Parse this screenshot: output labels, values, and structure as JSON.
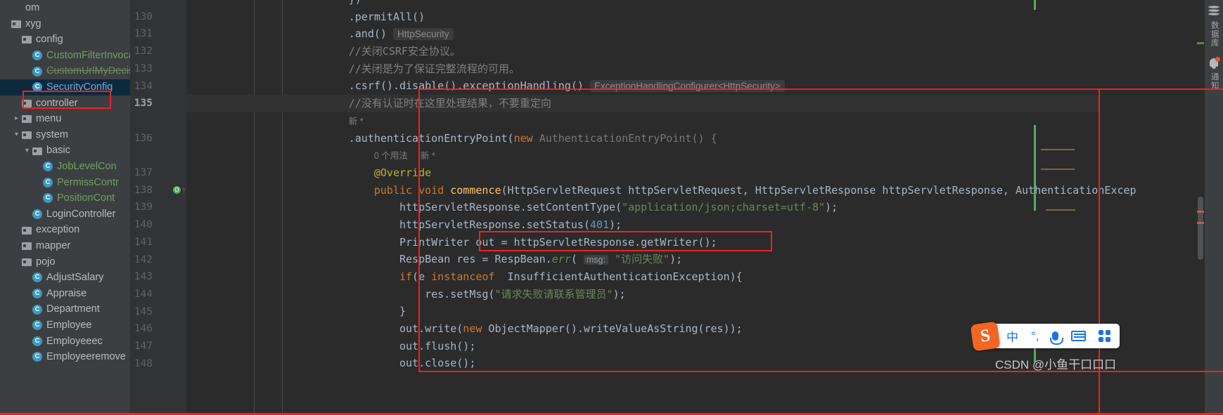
{
  "project_tree": {
    "name": "project-tool-window",
    "items": [
      {
        "depth": 0,
        "arrow": "",
        "icon": "none",
        "label": "om",
        "style": "gray"
      },
      {
        "depth": 0,
        "arrow": "",
        "icon": "folder",
        "label": "xyg",
        "style": "gray"
      },
      {
        "depth": 1,
        "arrow": "",
        "icon": "folder",
        "label": "config",
        "style": "gray"
      },
      {
        "depth": 2,
        "arrow": "",
        "icon": "class",
        "label": "CustomFilterInvoca",
        "style": "green"
      },
      {
        "depth": 2,
        "arrow": "",
        "icon": "class",
        "label": "CustomUrlMyDecis",
        "style": "struck"
      },
      {
        "depth": 2,
        "arrow": "",
        "icon": "class",
        "label": "SecurityConfig",
        "style": "selected",
        "selected": true
      },
      {
        "depth": 1,
        "arrow": "",
        "icon": "folder",
        "label": "controller",
        "style": "gray"
      },
      {
        "depth": 1,
        "arrow": "collapsed",
        "icon": "folder",
        "label": "menu",
        "style": "gray"
      },
      {
        "depth": 1,
        "arrow": "expanded",
        "icon": "folder",
        "label": "system",
        "style": "gray"
      },
      {
        "depth": 2,
        "arrow": "expanded",
        "icon": "folder",
        "label": "basic",
        "style": "gray"
      },
      {
        "depth": 3,
        "arrow": "",
        "icon": "class",
        "label": "JobLevelCon",
        "style": "green"
      },
      {
        "depth": 3,
        "arrow": "",
        "icon": "class",
        "label": "PermissContr",
        "style": "green"
      },
      {
        "depth": 3,
        "arrow": "",
        "icon": "class",
        "label": "PositionCont",
        "style": "green"
      },
      {
        "depth": 2,
        "arrow": "",
        "icon": "class",
        "label": "LoginController",
        "style": "gray"
      },
      {
        "depth": 1,
        "arrow": "",
        "icon": "folder",
        "label": "exception",
        "style": "gray"
      },
      {
        "depth": 1,
        "arrow": "",
        "icon": "folder",
        "label": "mapper",
        "style": "gray"
      },
      {
        "depth": 1,
        "arrow": "",
        "icon": "folder",
        "label": "pojo",
        "style": "gray"
      },
      {
        "depth": 2,
        "arrow": "",
        "icon": "class",
        "label": "AdjustSalary",
        "style": "gray"
      },
      {
        "depth": 2,
        "arrow": "",
        "icon": "class",
        "label": "Appraise",
        "style": "gray"
      },
      {
        "depth": 2,
        "arrow": "",
        "icon": "class",
        "label": "Department",
        "style": "gray"
      },
      {
        "depth": 2,
        "arrow": "",
        "icon": "class",
        "label": "Employee",
        "style": "gray"
      },
      {
        "depth": 2,
        "arrow": "",
        "icon": "class",
        "label": "Employeeec",
        "style": "gray"
      },
      {
        "depth": 2,
        "arrow": "",
        "icon": "class",
        "label": "Employeeremove",
        "style": "gray"
      }
    ]
  },
  "editor": {
    "line_numbers": [
      "130",
      "131",
      "132",
      "133",
      "134",
      "135",
      "136",
      "137",
      "138",
      "139",
      "140",
      "141",
      "142",
      "143",
      "144",
      "145",
      "146",
      "147",
      "148"
    ],
    "current_line": "135",
    "lines": [
      {
        "num": "",
        "text": "})"
      },
      {
        "num": "130",
        "text": ".permitAll()"
      },
      {
        "num": "131",
        "text": ".and()",
        "hint": "HttpSecurity"
      },
      {
        "num": "132",
        "text": "//关闭CSRF安全协议。"
      },
      {
        "num": "133",
        "text": "//关闭是为了保证完整流程的可用。"
      },
      {
        "num": "134",
        "text": ".csrf().disable().exceptionHandling()",
        "hint": "ExceptionHandlingConfigurer<HttpSecurity>"
      },
      {
        "num": "135",
        "text": "//没有认证时在这里处理结果，不要重定向"
      },
      {
        "num": "",
        "text": "新 *"
      },
      {
        "num": "136",
        "text": ".authenticationEntryPoint(new AuthenticationEntryPoint() {"
      },
      {
        "num": "",
        "text": "0 个用法   新 *"
      },
      {
        "num": "137",
        "text": "@Override"
      },
      {
        "num": "138",
        "text": "public void commence(HttpServletRequest httpServletRequest, HttpServletResponse httpServletResponse, AuthenticationExcep"
      },
      {
        "num": "139",
        "text": "httpServletResponse.setContentType(\"application/json;charset=utf-8\");"
      },
      {
        "num": "140",
        "text": "httpServletResponse.setStatus(401);"
      },
      {
        "num": "141",
        "text": "PrintWriter out = httpServletResponse.getWriter();"
      },
      {
        "num": "142",
        "text": "RespBean res = RespBean.err( msg: \"访问失败\");"
      },
      {
        "num": "143",
        "text": "if(e instanceof  InsufficientAuthenticationException){"
      },
      {
        "num": "144",
        "text": "res.setMsg(\"请求失败请联系管理员\");"
      },
      {
        "num": "145",
        "text": "}"
      },
      {
        "num": "146",
        "text": "out.write(new ObjectMapper().writeValueAsString(res));"
      },
      {
        "num": "147",
        "text": "out.flush();"
      },
      {
        "num": "148",
        "text": "out.close();"
      }
    ],
    "inlay_hints": {
      "http_security": "HttpSecurity",
      "exception_handling_configurer": "ExceptionHandlingConfigurer<HttpSecurity>",
      "msg_param": "msg:",
      "new_marker": "新 *",
      "usages": "0 个用法",
      "new_marker2": "新 *"
    },
    "gutter_icons": {
      "intention_bulb_line": "135",
      "override_marker_line": "138"
    }
  },
  "right_toolbar": {
    "items": [
      {
        "icon": "database-icon",
        "label": "数据库"
      },
      {
        "icon": "bell-icon",
        "label": "通知"
      }
    ]
  },
  "ime_toolbar": {
    "logo": "S",
    "items": [
      {
        "name": "language-mode",
        "label": "中"
      },
      {
        "name": "punctuation-mode",
        "label": "°,"
      },
      {
        "name": "voice-input",
        "label": "mic"
      },
      {
        "name": "soft-keyboard",
        "label": "keyboard"
      },
      {
        "name": "toolbox",
        "label": "grid"
      }
    ]
  },
  "watermark": {
    "text": "CSDN @小鱼干口口口"
  },
  "colors": {
    "accent_red": "#ee2222",
    "editor_bg": "#2b2b2b",
    "panel_bg": "#3c3f41",
    "gutter_bg": "#313335",
    "selection_bg": "#0d293e",
    "keyword": "#cc7832",
    "string": "#6a8759",
    "number": "#6897bb",
    "comment": "#808080",
    "annotation": "#bbb529",
    "method": "#ffc66d",
    "default_text": "#a9b7c6"
  }
}
